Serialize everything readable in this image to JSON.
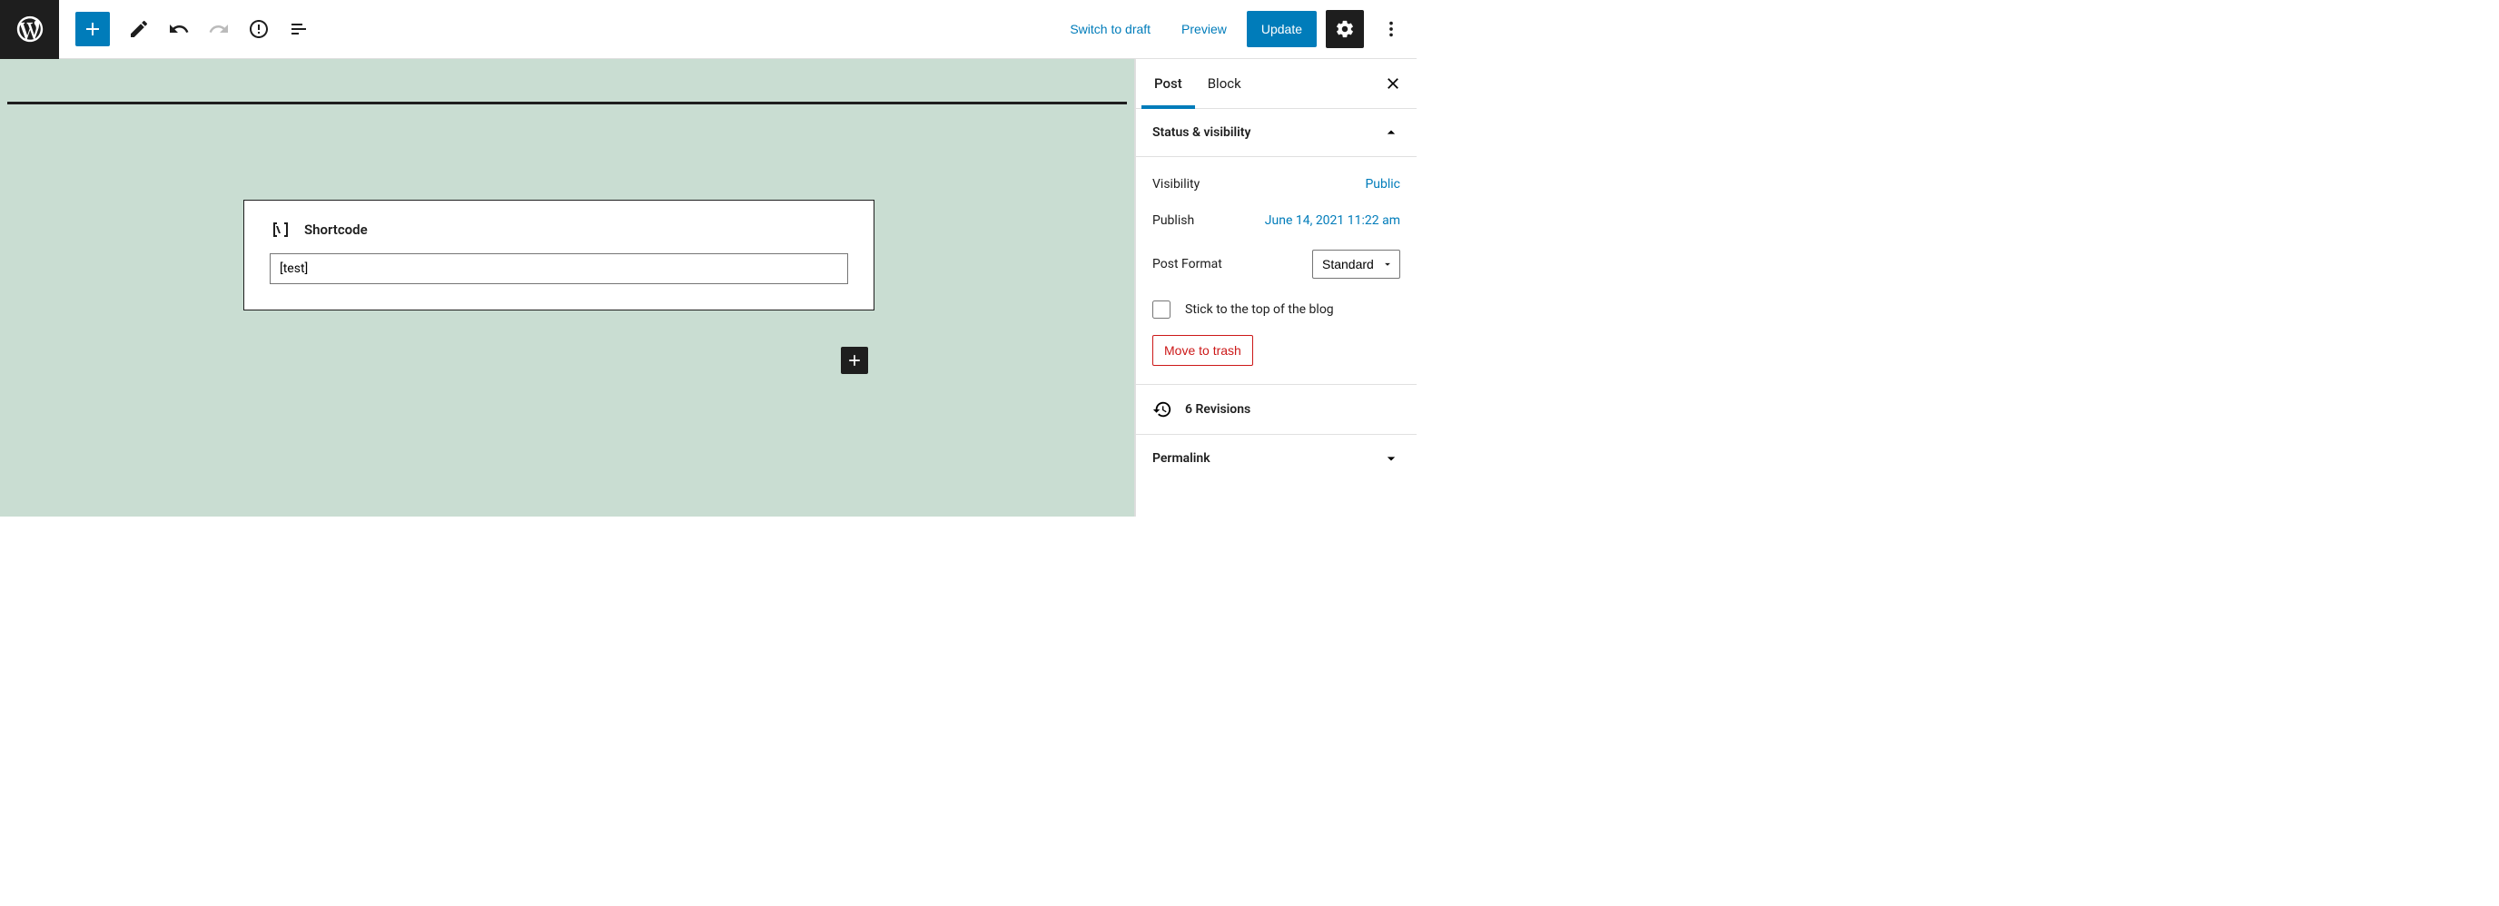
{
  "toolbar": {
    "switch_to_draft": "Switch to draft",
    "preview": "Preview",
    "update": "Update"
  },
  "canvas": {
    "shortcode_block": {
      "title": "Shortcode",
      "value": "[test]"
    }
  },
  "sidebar": {
    "tabs": {
      "post": "Post",
      "block": "Block"
    },
    "panel_status_title": "Status & visibility",
    "visibility_label": "Visibility",
    "visibility_value": "Public",
    "publish_label": "Publish",
    "publish_value": "June 14, 2021 11:22 am",
    "post_format_label": "Post Format",
    "post_format_value": "Standard",
    "stick_label": "Stick to the top of the blog",
    "trash_label": "Move to trash",
    "revisions_label": "6 Revisions",
    "permalink_label": "Permalink"
  }
}
